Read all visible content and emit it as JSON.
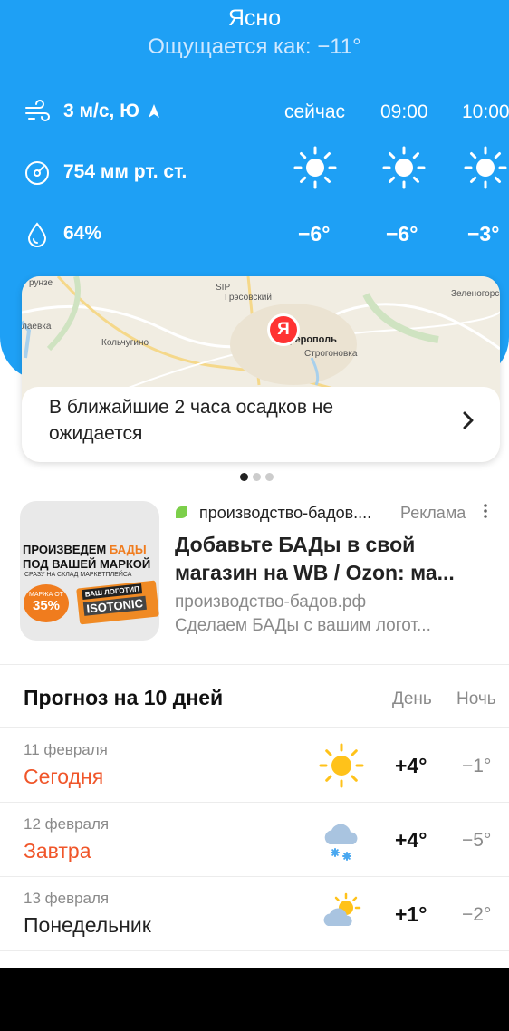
{
  "current": {
    "condition": "Ясно",
    "feels_like": "Ощущается как: −11°",
    "wind": "3 м/с, Ю",
    "pressure": "754 мм рт. ст.",
    "humidity": "64%"
  },
  "hourly": [
    {
      "time": "сейчас",
      "temp": "−6°",
      "icon": "sun-icon"
    },
    {
      "time": "09:00",
      "temp": "−6°",
      "icon": "sun-icon"
    },
    {
      "time": "10:00",
      "temp": "−3°",
      "icon": "sun-icon"
    }
  ],
  "map": {
    "labels": [
      "рунзе",
      "SIP",
      "Грэсовский",
      "Зеленогорск",
      "лаевка",
      "Кольчугино",
      "ферополь",
      "Строгоновка"
    ],
    "pin_letter": "Я",
    "precip_text": "В ближайшие 2 часа осадков не ожидается"
  },
  "ad": {
    "image_line1_a": "ПРОИЗВЕДЕМ ",
    "image_line1_b": "БАДЫ",
    "image_line2": "ПОД ВАШЕЙ МАРКОЙ",
    "image_line3": "СРАЗУ НА СКЛАД МАРКЕТПЛЕЙСА",
    "image_badge_small": "МАРЖА ОТ",
    "image_badge_big": "35%",
    "image_box_logo": "ВАШ ЛОГОТИП",
    "image_box_name": "ISOTONIC",
    "host": "производство-бадов....",
    "mark": "Реклама",
    "title_line1": "Добавьте БАДы в свой",
    "title_line2": "магазин на WB / Ozon: ма...",
    "url": "производство-бадов.рф",
    "description": "Сделаем БАДы с вашим логот..."
  },
  "forecast": {
    "title": "Прогноз на 10 дней",
    "day_label": "День",
    "night_label": "Ночь",
    "rows": [
      {
        "date": "11 февраля",
        "name": "Сегодня",
        "day": "+4°",
        "night": "−1°",
        "icon": "sun-icon"
      },
      {
        "date": "12 февраля",
        "name": "Завтра",
        "day": "+4°",
        "night": "−5°",
        "icon": "cloud-snow-icon"
      },
      {
        "date": "13 февраля",
        "name": "Понедельник",
        "day": "+1°",
        "night": "−2°",
        "icon": "partly-cloudy-icon"
      }
    ]
  },
  "colors": {
    "header_blue": "#1ea0f5",
    "accent_red": "#f0562a",
    "sun_yellow": "#ffc21a"
  }
}
